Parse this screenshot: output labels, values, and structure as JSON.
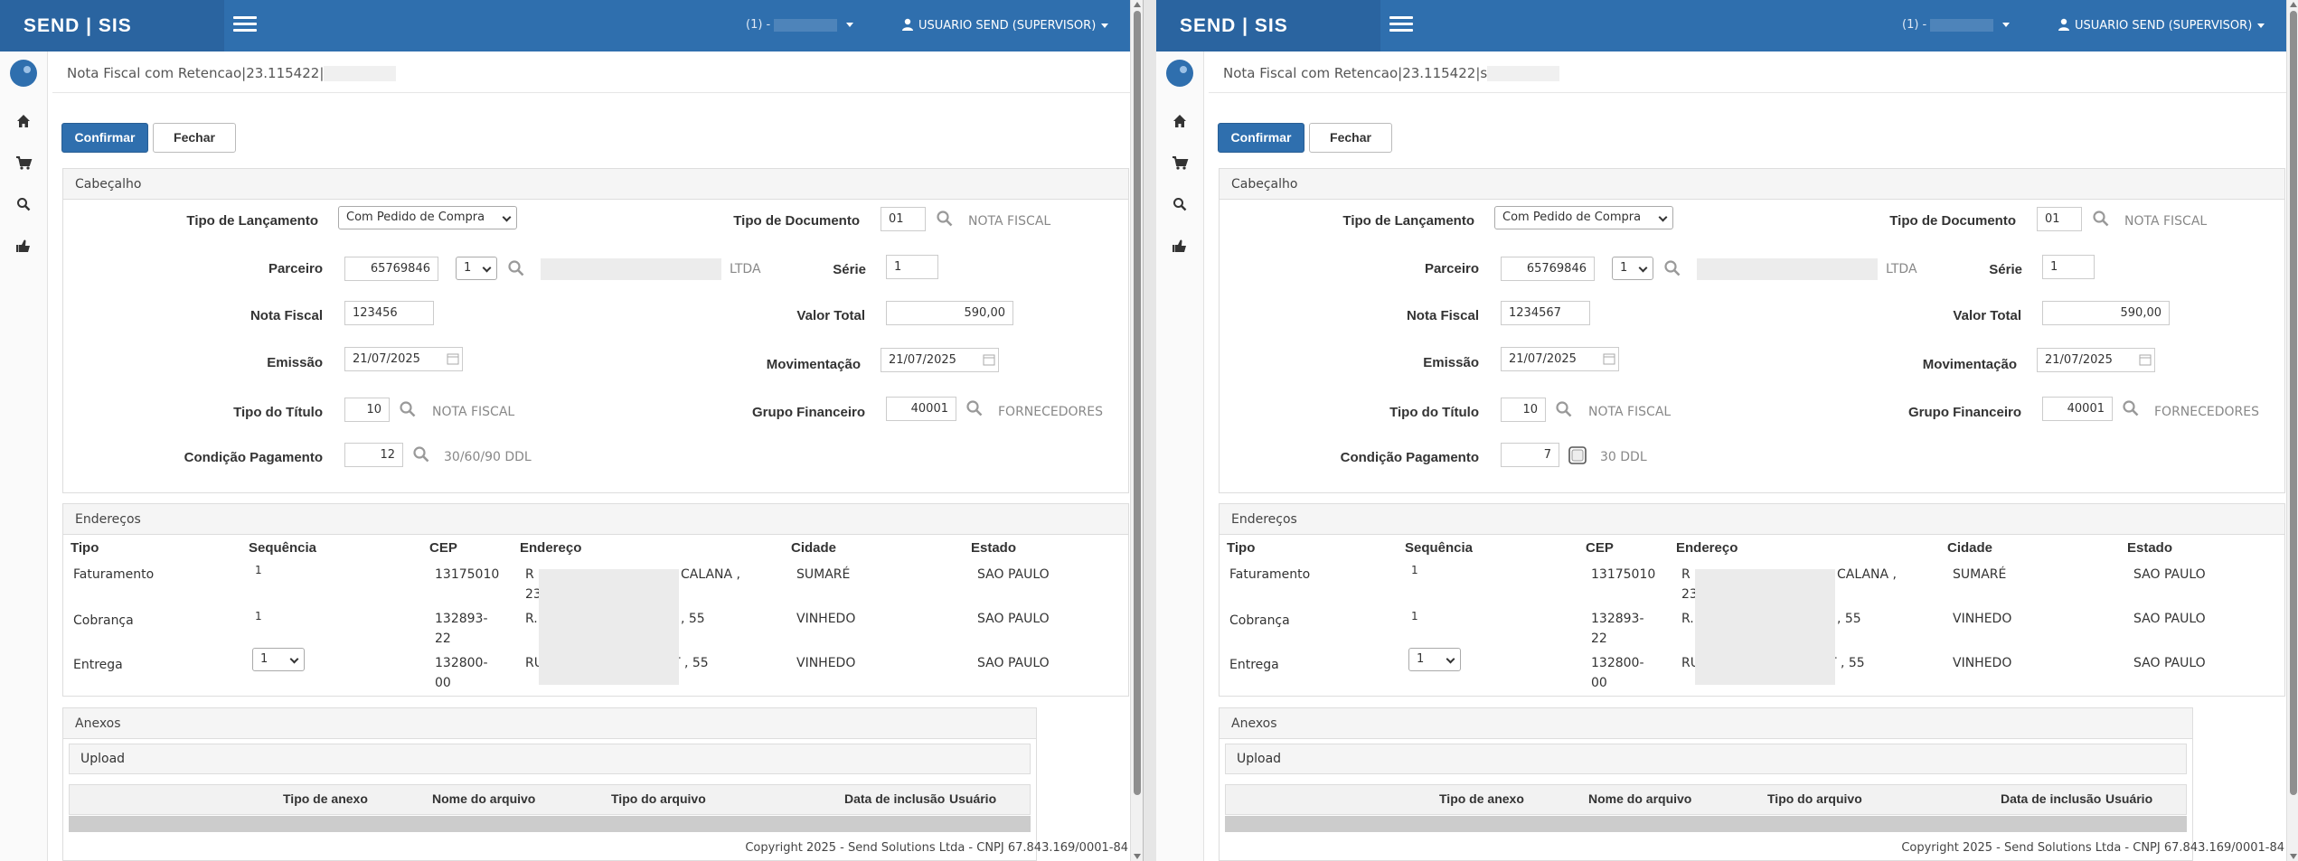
{
  "header": {
    "brand": "SEND | SIS",
    "company_prefix": "(1) -",
    "user": "USUARIO SEND (SUPERVISOR)"
  },
  "page": {
    "title_left": "Nota Fiscal com Retencao|23.115422|",
    "title_right": "Nota Fiscal com Retencao|23.115422|s"
  },
  "buttons": {
    "confirm": "Confirmar",
    "close": "Fechar"
  },
  "header_panel": {
    "title": "Cabeçalho",
    "labels": {
      "tipo_lancamento": "Tipo de Lançamento",
      "parceiro": "Parceiro",
      "nota_fiscal": "Nota Fiscal",
      "emissao": "Emissão",
      "tipo_titulo": "Tipo do Título",
      "condicao_pagamento": "Condição Pagamento",
      "tipo_documento": "Tipo de Documento",
      "serie": "Série",
      "valor_total": "Valor Total",
      "movimentacao": "Movimentação",
      "grupo_financeiro": "Grupo Financeiro"
    }
  },
  "forms": {
    "left": {
      "tipo_lancamento": "Com Pedido de Compra",
      "parceiro_codigo": "65769846",
      "parceiro_seq": "1",
      "parceiro_suffix": "LTDA",
      "nota_fiscal": "123456",
      "emissao": "21/07/2025",
      "tipo_titulo": "10",
      "tipo_titulo_desc": "NOTA FISCAL",
      "condicao_pagamento": "12",
      "condicao_desc": "30/60/90 DDL",
      "tipo_documento": "01",
      "tipo_documento_desc": "NOTA FISCAL",
      "serie": "1",
      "valor_total": "590,00",
      "movimentacao": "21/07/2025",
      "grupo_financeiro": "40001",
      "grupo_financeiro_desc": "FORNECEDORES"
    },
    "right": {
      "tipo_lancamento": "Com Pedido de Compra",
      "parceiro_codigo": "65769846",
      "parceiro_seq": "1",
      "parceiro_suffix": "LTDA",
      "nota_fiscal": "1234567",
      "emissao": "21/07/2025",
      "tipo_titulo": "10",
      "tipo_titulo_desc": "NOTA FISCAL",
      "condicao_pagamento": "7",
      "condicao_desc": "30 DDL",
      "tipo_documento": "01",
      "tipo_documento_desc": "NOTA FISCAL",
      "serie": "1",
      "valor_total": "590,00",
      "movimentacao": "21/07/2025",
      "grupo_financeiro": "40001",
      "grupo_financeiro_desc": "FORNECEDORES"
    }
  },
  "addresses": {
    "title": "Endereços",
    "columns": [
      "Tipo",
      "Sequência",
      "CEP",
      "Endereço",
      "Cidade",
      "Estado"
    ],
    "rows": [
      {
        "tipo": "Faturamento",
        "seq": "1",
        "cep1": "13175010",
        "cep2": "",
        "end1": "R",
        "end_tail": "CALANA ,",
        "end2": "23",
        "cidade": "SUMARÉ",
        "estado": "SAO PAULO"
      },
      {
        "tipo": "Cobrança",
        "seq": "1",
        "cep1": "132893-",
        "cep2": "22",
        "end1": "R.",
        "end_tail": ", 55",
        "end2": "",
        "cidade": "VINHEDO",
        "estado": "SAO PAULO"
      },
      {
        "tipo": "Entrega",
        "seq": "1",
        "cep1": "132800-",
        "cep2": "00",
        "end1": "RU",
        "end_tail": "T , 55",
        "end2": "",
        "cidade": "VINHEDO",
        "estado": "SAO PAULO"
      }
    ]
  },
  "attachments": {
    "title": "Anexos",
    "upload": "Upload",
    "columns": [
      "Tipo de anexo",
      "Nome do arquivo",
      "Tipo do arquivo",
      "Data de inclusão",
      "Usuário"
    ]
  },
  "footer": "Copyright 2025 - Send Solutions Ltda - CNPJ 67.843.169/0001-84"
}
